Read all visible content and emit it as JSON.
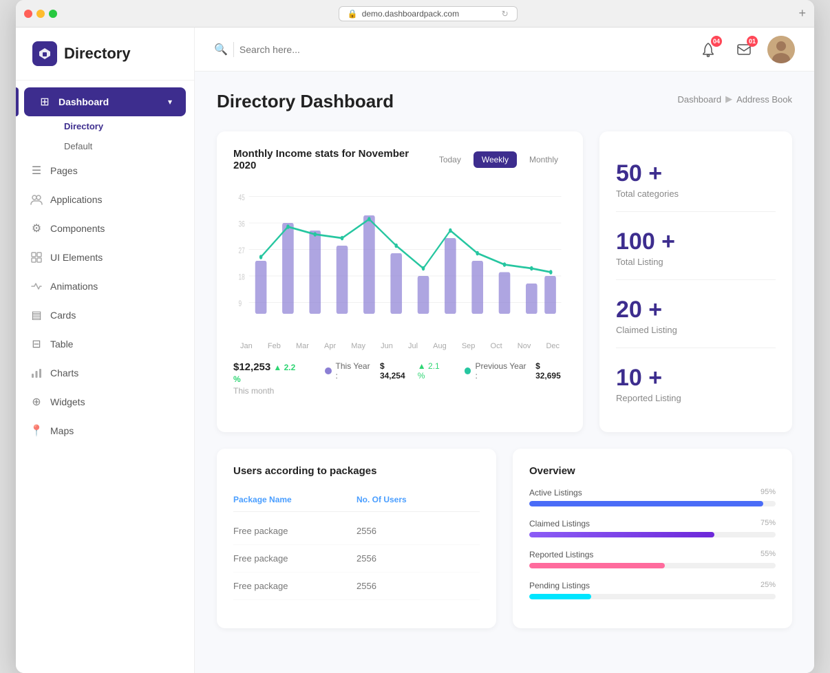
{
  "titlebar": {
    "url": "demo.dashboardpack.com"
  },
  "sidebar": {
    "logo_text": "Directory",
    "nav_items": [
      {
        "id": "dashboard",
        "label": "Dashboard",
        "icon": "⊞",
        "active": true,
        "has_chevron": true
      },
      {
        "id": "pages",
        "label": "Pages",
        "icon": "☰",
        "active": false
      },
      {
        "id": "applications",
        "label": "Applications",
        "icon": "👥",
        "active": false
      },
      {
        "id": "components",
        "label": "Components",
        "icon": "⚙",
        "active": false
      },
      {
        "id": "ui-elements",
        "label": "UI Elements",
        "icon": "◱",
        "active": false
      },
      {
        "id": "animations",
        "label": "Animations",
        "icon": "◈",
        "active": false
      },
      {
        "id": "cards",
        "label": "Cards",
        "icon": "▤",
        "active": false
      },
      {
        "id": "table",
        "label": "Table",
        "icon": "⊟",
        "active": false
      },
      {
        "id": "charts",
        "label": "Charts",
        "icon": "📊",
        "active": false
      },
      {
        "id": "widgets",
        "label": "Widgets",
        "icon": "⊕",
        "active": false
      },
      {
        "id": "maps",
        "label": "Maps",
        "icon": "📍",
        "active": false
      }
    ],
    "sub_items": [
      {
        "label": "Directory",
        "active": true
      },
      {
        "label": "Default",
        "active": false
      }
    ]
  },
  "topbar": {
    "search_placeholder": "Search here...",
    "notification_count": "04",
    "message_count": "01"
  },
  "page": {
    "title": "Directory Dashboard",
    "breadcrumb_root": "Dashboard",
    "breadcrumb_current": "Address Book"
  },
  "chart": {
    "title": "Monthly Income stats for November 2020",
    "filters": [
      "Today",
      "Weekly",
      "Monthly"
    ],
    "active_filter": "Weekly",
    "months": [
      "Jan",
      "Feb",
      "Mar",
      "Apr",
      "May",
      "Jun",
      "Jul",
      "Aug",
      "Sep",
      "Oct",
      "Nov",
      "Dec"
    ],
    "this_month_value": "$12,253",
    "this_month_change": "2.2 %",
    "this_month_label": "This month",
    "this_year_value": "$ 34,254",
    "this_year_change": "2.1 %",
    "prev_year_value": "$ 32,695",
    "legend_this_year": "This Year :",
    "legend_prev_year": "Previous Year :"
  },
  "stats": [
    {
      "number": "50 +",
      "label": "Total categories"
    },
    {
      "number": "100 +",
      "label": "Total Listing"
    },
    {
      "number": "20 +",
      "label": "Claimed Listing"
    },
    {
      "number": "10 +",
      "label": "Reported Listing"
    }
  ],
  "packages_table": {
    "title": "Users according to packages",
    "col1": "Package Name",
    "col2": "No. Of Users",
    "rows": [
      {
        "name": "Free package",
        "users": "2556"
      },
      {
        "name": "Free package",
        "users": "2556"
      },
      {
        "name": "Free package",
        "users": "2556"
      }
    ]
  },
  "overview": {
    "title": "Overview",
    "items": [
      {
        "label": "Active Listings",
        "pct": 95,
        "color": "#4a6cf7"
      },
      {
        "label": "Claimed Listings",
        "pct": 75,
        "color": "#9b59b6"
      },
      {
        "label": "Reported Listings",
        "pct": 55,
        "color": "#ff6b9d"
      },
      {
        "label": "Pending Listings",
        "pct": 25,
        "color": "#00e5ff"
      }
    ]
  }
}
